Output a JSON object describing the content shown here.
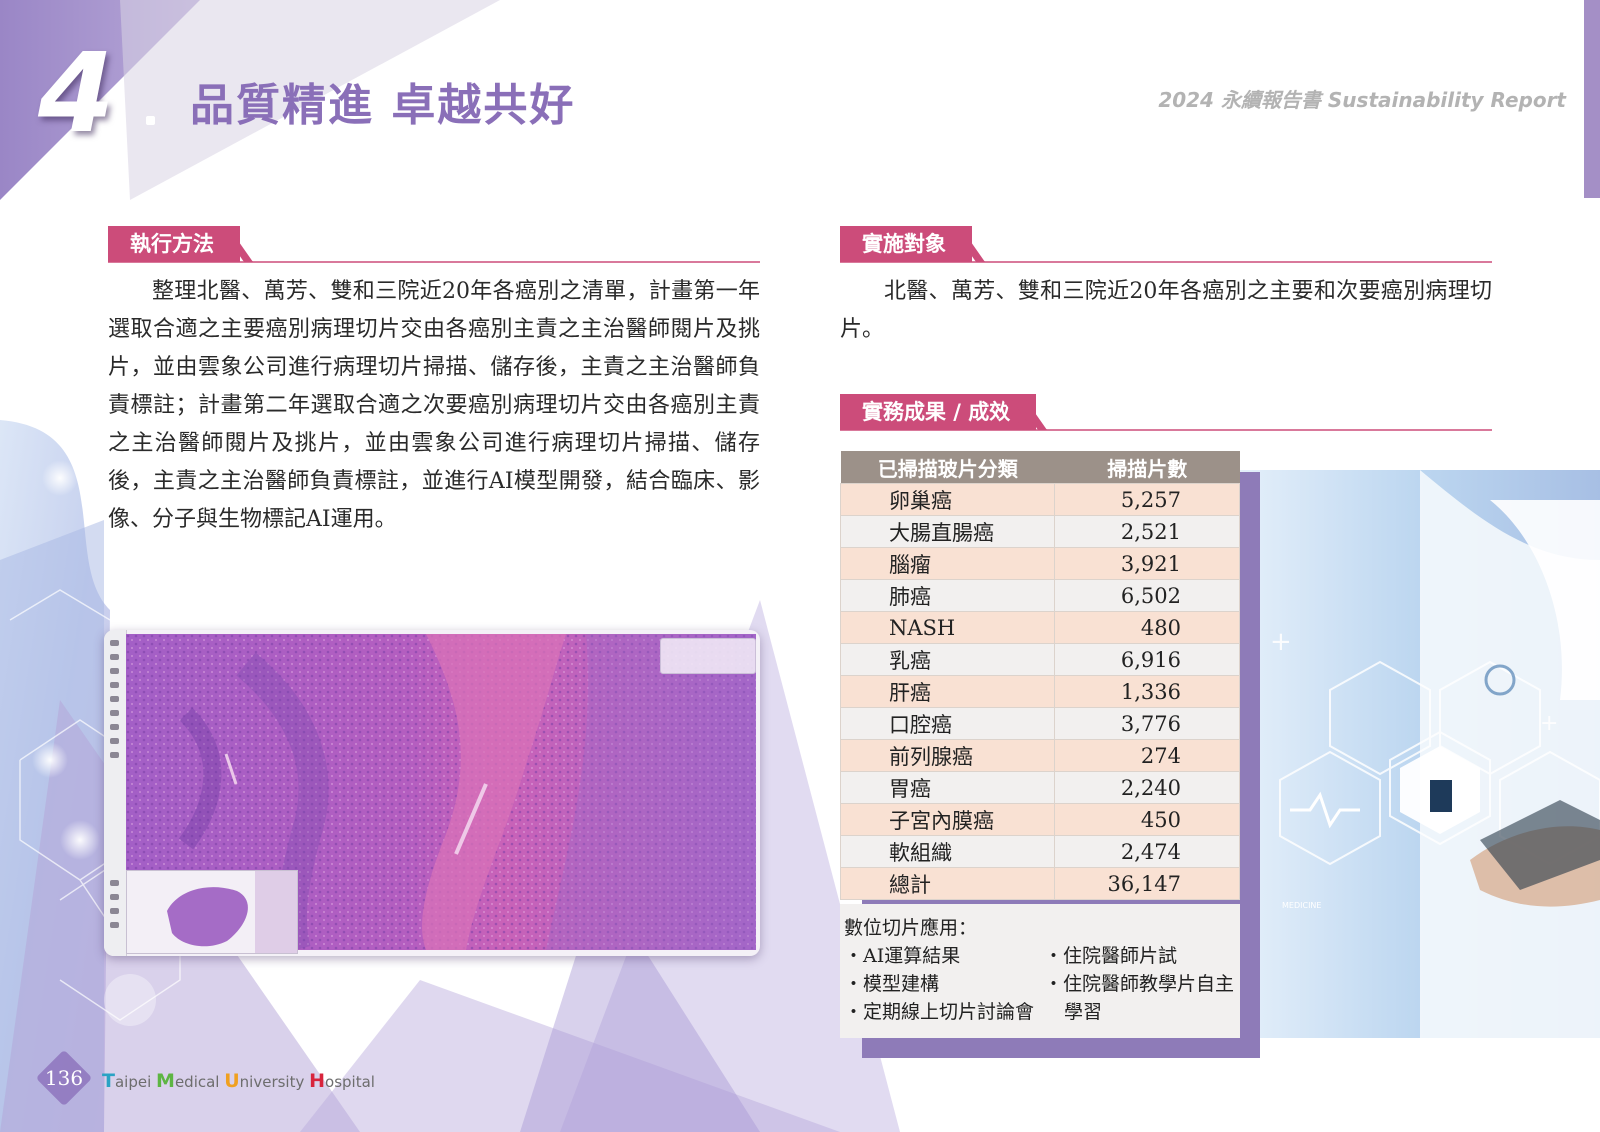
{
  "header": {
    "chapter_number": "4",
    "chapter_title": "品質精進 卓越共好",
    "report_title": "2024 永續報告書 Sustainability Report"
  },
  "method": {
    "title": "執行方法",
    "paragraph": "整理北醫、萬芳、雙和三院近20年各癌別之清單，計畫第一年選取合適之主要癌別病理切片交由各癌別主責之主治醫師閱片及挑片，並由雲象公司進行病理切片掃描、儲存後，主責之主治醫師負責標註；計畫第二年選取合適之次要癌別病理切片交由各癌別主責之主治醫師閱片及挑片，並由雲象公司進行病理切片掃描、儲存後，主責之主治醫師負責標註，並進行AI模型開發，結合臨床、影像、分子與生物標記AI運用。"
  },
  "target": {
    "title": "實施對象",
    "paragraph": "北醫、萬芳、雙和三院近20年各癌別之主要和次要癌別病理切片。"
  },
  "results": {
    "title": "實務成果 / 成效",
    "table": {
      "headers": [
        "已掃描玻片分類",
        "掃描片數"
      ],
      "rows": [
        {
          "category": "卵巢癌",
          "count": "5,257"
        },
        {
          "category": "大腸直腸癌",
          "count": "2,521"
        },
        {
          "category": "腦瘤",
          "count": "3,921"
        },
        {
          "category": "肺癌",
          "count": "6,502"
        },
        {
          "category": "NASH",
          "count": "480"
        },
        {
          "category": "乳癌",
          "count": "6,916"
        },
        {
          "category": "肝癌",
          "count": "1,336"
        },
        {
          "category": "口腔癌",
          "count": "3,776"
        },
        {
          "category": "前列腺癌",
          "count": "274"
        },
        {
          "category": "胃癌",
          "count": "2,240"
        },
        {
          "category": "子宮內膜癌",
          "count": "450"
        },
        {
          "category": "軟組織",
          "count": "2,474"
        }
      ],
      "total": {
        "category": "總計",
        "count": "36,147"
      }
    },
    "applications": {
      "title": "數位切片應用：",
      "left": [
        "・AI運算結果",
        "・模型建構",
        "・定期線上切片討論會"
      ],
      "right": [
        "・住院醫師片試",
        "・住院醫師教學片自主",
        "學習"
      ]
    }
  },
  "footer": {
    "page_number": "136",
    "brand": [
      {
        "initial": "T",
        "rest": "aipei ",
        "color": "#2aa3c4"
      },
      {
        "initial": "M",
        "rest": "edical ",
        "color": "#5db543"
      },
      {
        "initial": "U",
        "rest": "niversity ",
        "color": "#f0a020"
      },
      {
        "initial": "H",
        "rest": "ospital",
        "color": "#d8243c"
      }
    ]
  },
  "colors": {
    "accent": "#cc4c7a",
    "title_purple": "#8a6fb8",
    "table_header": "#9c9189",
    "row_peach": "#f9e1d3",
    "row_gray": "#f2f0ef"
  }
}
